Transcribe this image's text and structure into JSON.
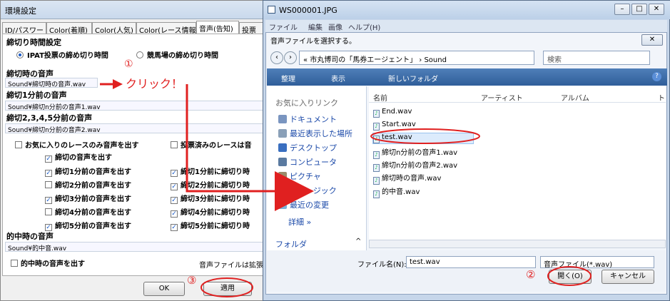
{
  "left": {
    "title": "環境設定",
    "tabs": [
      "ID/パスワード",
      "Color(着順)",
      "Color(人気)",
      "Color(レース情報)",
      "音声(告知)",
      "投票"
    ],
    "deadline_header": "締切り時間設定",
    "radio_ipat": "IPAT投票の締め切り時間",
    "radio_keiba": "競馬場の締め切り時間",
    "sec1_title": "締切時の音声",
    "sec1_value": "Sound¥締切時の音声.wav",
    "sec2_title": "締切1分前の音声",
    "sec2_value": "Sound¥締切n分前の音声1.wav",
    "sec3_title": "締切2,3,4,5分前の音声",
    "sec3_value": "Sound¥締切n分前の音声2.wav",
    "fav_only": "お気に入りのレースのみ音声を出す",
    "voted_skip": "投票済みのレースは音",
    "chk_close_sound": "締切の音声を出す",
    "left_checks": [
      "締切1分前の音声を出す",
      "締切2分前の音声を出す",
      "締切3分前の音声を出す",
      "締切4分前の音声を出す",
      "締切5分前の音声を出す"
    ],
    "right_checks": [
      "締切1分前に締切り時",
      "締切2分前に締切り時",
      "締切3分前に締切り時",
      "締切4分前に締切り時",
      "締切5分前に締切り時"
    ],
    "hit_title": "的中時の音声",
    "hit_value": "Sound¥的中音.wav",
    "hit_check": "的中時の音声を出す",
    "ext_note": "音声ファイルは拡張子",
    "ok_label": "OK",
    "apply_label": "適用"
  },
  "annotations": {
    "step1": "①",
    "click_text": "クリック！",
    "step2": "②",
    "step3": "③",
    "color": "#e02020"
  },
  "right": {
    "window_title": "WS000001.JPG",
    "menu": [
      "ファイル",
      "編集",
      "画像",
      "ヘルプ(H)"
    ],
    "dialog_title": "音声ファイルを選択する。",
    "address": "« 市丸博司の「馬券エージェント」 › Sound",
    "search_placeholder": "検索",
    "toolbar": {
      "organize": "整理",
      "view": "表示",
      "new_folder": "新しいフォルダ"
    },
    "nav_header": "お気に入りリンク",
    "nav_items": [
      "ドキュメント",
      "最近表示した場所",
      "デスクトップ",
      "コンピュータ",
      "ピクチャ",
      "ミュージック",
      "最近の変更"
    ],
    "nav_more": "詳細 »",
    "folders_label": "フォルダ",
    "columns": [
      "名前",
      "アーティスト",
      "アルバム",
      "ト"
    ],
    "files": [
      "End.wav",
      "Start.wav",
      "test.wav",
      "締切n分前の音声1.wav",
      "締切n分前の音声2.wav",
      "締切時の音声.wav",
      "的中音.wav"
    ],
    "filename_label": "ファイル名(N):",
    "filename_value": "test.wav",
    "filetype_value": "音声ファイル(*.wav)",
    "open_label": "開く(O)",
    "cancel_label": "キャンセル"
  }
}
